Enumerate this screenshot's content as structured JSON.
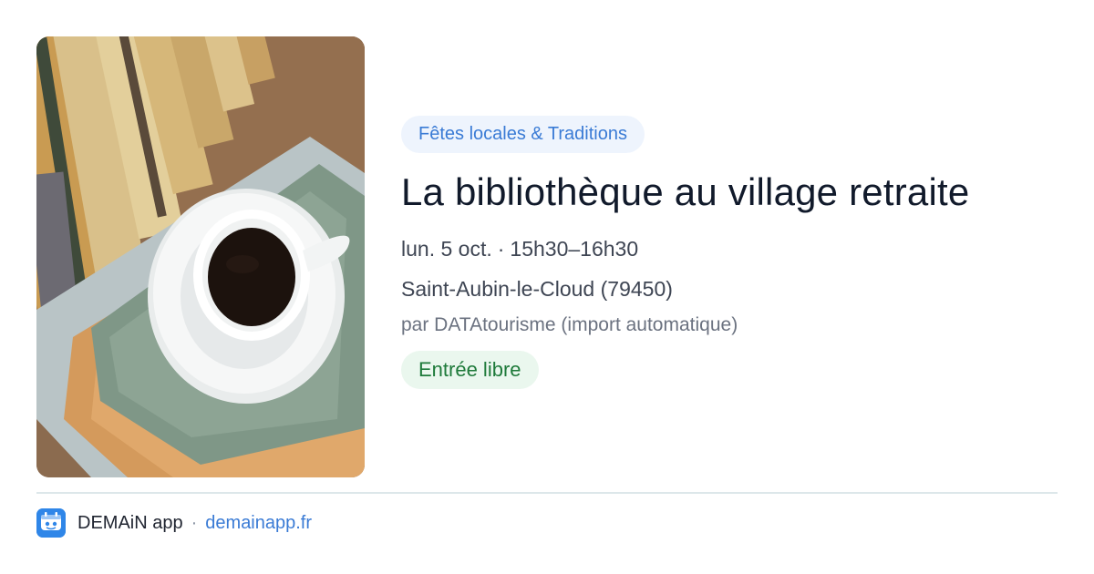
{
  "event": {
    "category": "Fêtes locales & Traditions",
    "title": "La bibliothèque au village retraite",
    "date": "lun. 5 oct.",
    "separator": "·",
    "time": "15h30–16h30",
    "location": "Saint-Aubin-le-Cloud (79450)",
    "source": "par DATAtourisme (import automatique)",
    "price": "Entrée libre",
    "image_alt": "Tasse de café sur une pile de livres"
  },
  "footer": {
    "brand": "DEMAiN app",
    "separator": "·",
    "url": "demainapp.fr",
    "logo_icon": "demain-app-logo-icon"
  },
  "colors": {
    "category_bg": "#eef4fd",
    "category_text": "#3a7bd5",
    "title_text": "#111a2b",
    "price_bg": "#eaf7ee",
    "price_text": "#1e7a3a",
    "link": "#3a7bd5",
    "logo_bg": "#2f86e8"
  }
}
